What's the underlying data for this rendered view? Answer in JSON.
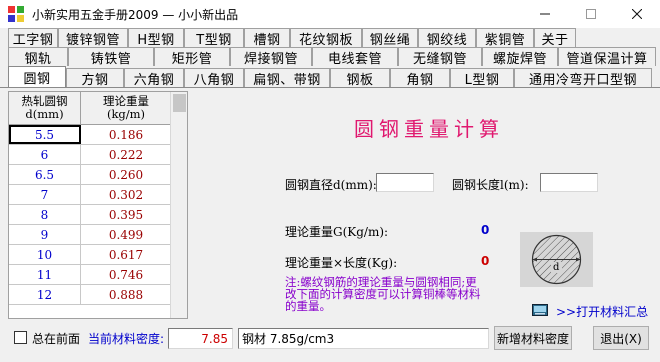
{
  "window": {
    "title": "小新实用五金手册2009 — 小小新出品",
    "minimize": "—",
    "maximize": "☐",
    "close": "✕"
  },
  "tabs": {
    "row1": [
      "工字钢",
      "镀锌钢管",
      "H型钢",
      "T型钢",
      "槽钢",
      "花纹钢板",
      "钢丝绳",
      "钢绞线",
      "紫铜管",
      "关于"
    ],
    "row2": [
      "钢轨",
      "铸铁管",
      "矩形管",
      "焊接钢管",
      "电线套管",
      "无缝钢管",
      "螺旋焊管",
      "管道保温计算"
    ],
    "row3": [
      "圆钢",
      "方钢",
      "六角钢",
      "八角钢",
      "扁钢、带钢",
      "钢板",
      "角钢",
      "L型钢",
      "通用冷弯开口型钢"
    ],
    "active": "圆钢"
  },
  "grid": {
    "col1_line1": "热轧圆钢",
    "col1_line2": "d(mm)",
    "col2_line1": "理论重量",
    "col2_line2": "(kg/m)",
    "rows": [
      {
        "d": "5.5",
        "w": "0.186"
      },
      {
        "d": "6",
        "w": "0.222"
      },
      {
        "d": "6.5",
        "w": "0.260"
      },
      {
        "d": "7",
        "w": "0.302"
      },
      {
        "d": "8",
        "w": "0.395"
      },
      {
        "d": "9",
        "w": "0.499"
      },
      {
        "d": "10",
        "w": "0.617"
      },
      {
        "d": "11",
        "w": "0.746"
      },
      {
        "d": "12",
        "w": "0.888"
      }
    ]
  },
  "calc": {
    "title": "圆钢重量计算",
    "diameter_label": "圆钢直径d(mm):",
    "diameter_value": "",
    "length_label": "圆钢长度l(m):",
    "length_value": "",
    "weight_per_m_label": "理论重量G(Kg/m):",
    "weight_per_m_value": "0",
    "total_label": "理论重量×长度(Kg):",
    "total_value": "0",
    "note": "注:螺纹钢筋的理论重量与圆钢相同;更改下面的计算密度可以计算铜棒等材料的重量。",
    "diagram_label": "d",
    "open_link": ">>打开材料汇总"
  },
  "bottom": {
    "always_on_top_label": "总在前面",
    "always_on_top_checked": false,
    "density_label": "当前材料密度:",
    "density_value": "7.85",
    "material_select": "钢材 7.85g/cm3",
    "add_density_button": "新增材料密度",
    "exit_button": "退出(X)"
  },
  "colors": {
    "title_pink": "#e0186f",
    "blue": "#0000cc",
    "red": "#cc0000",
    "purple": "#8800cc",
    "dark_red": "#990000"
  }
}
